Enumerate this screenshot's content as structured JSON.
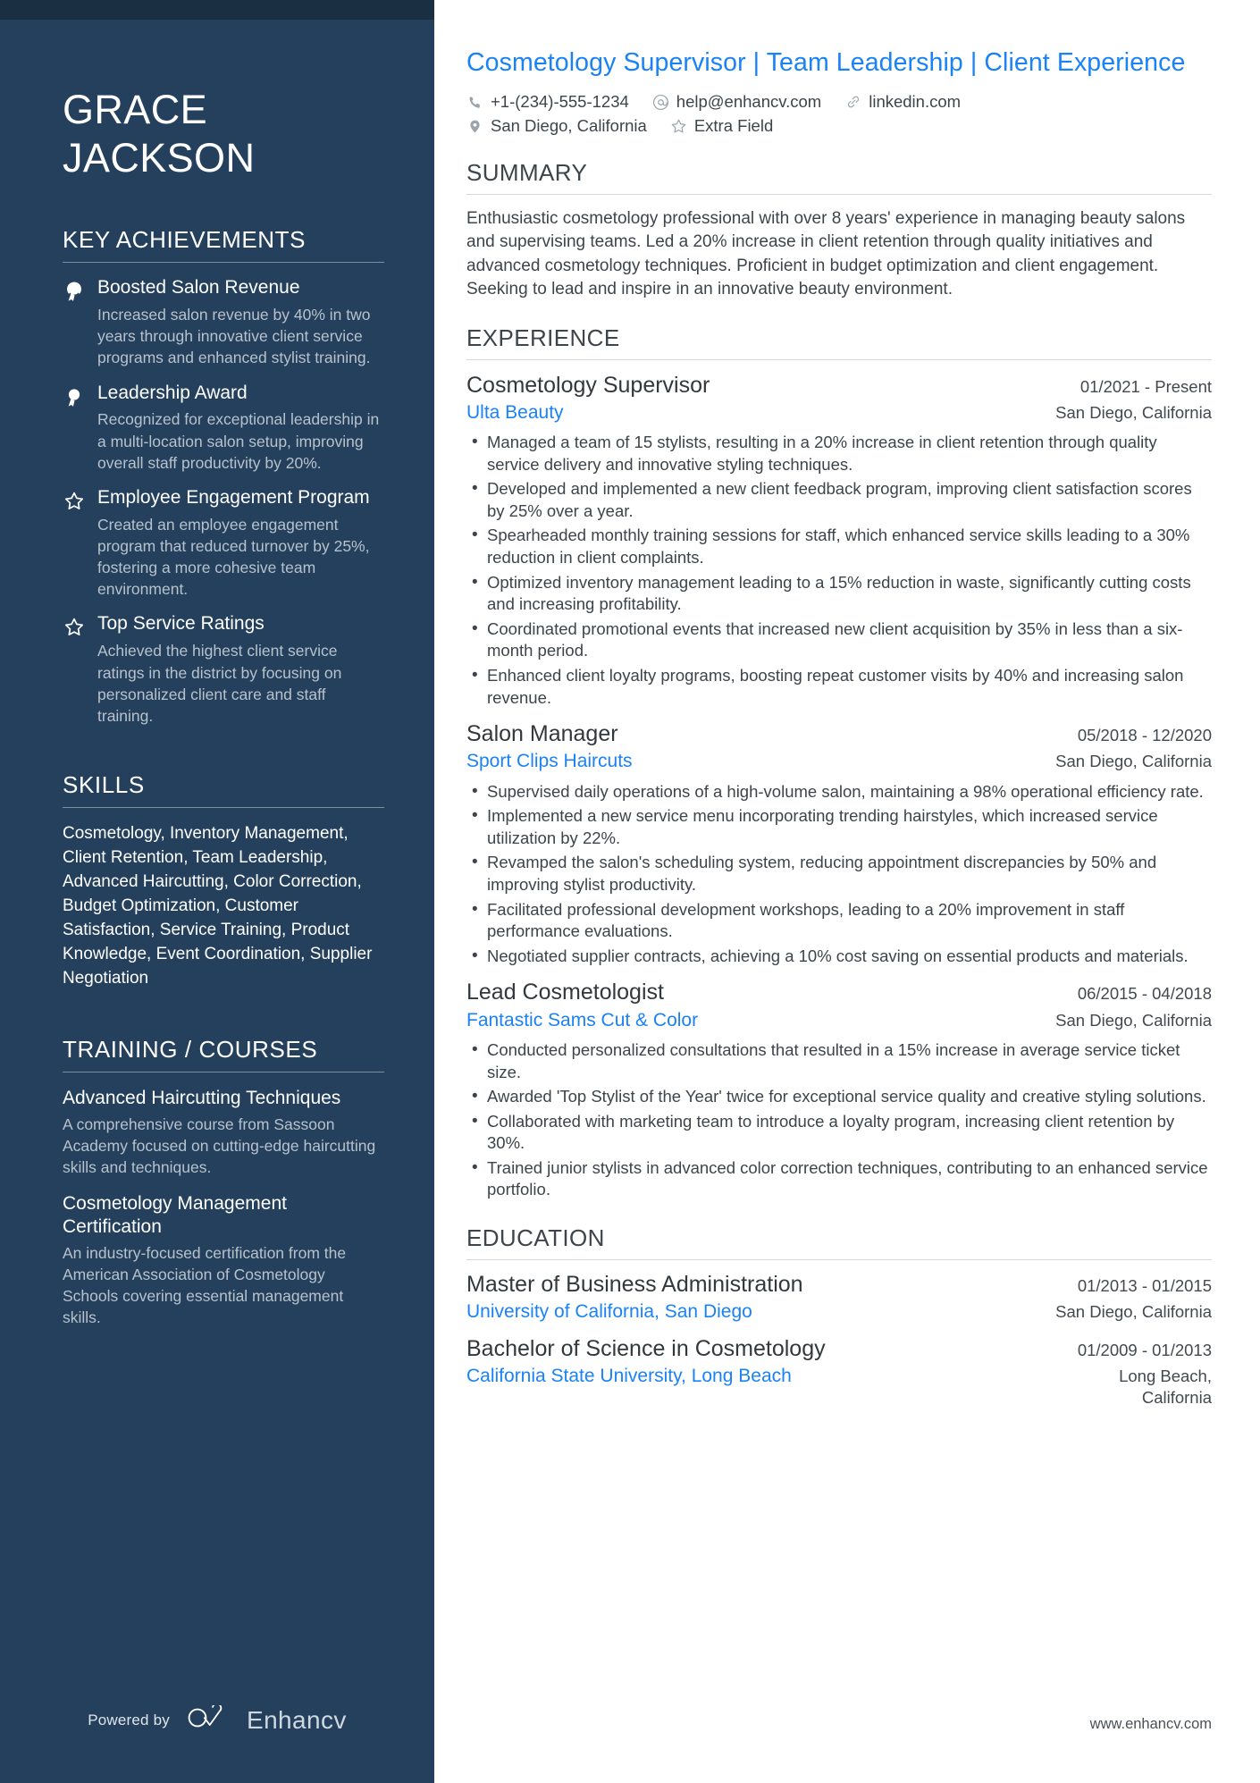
{
  "person": {
    "name": "GRACE\nJACKSON",
    "headline": "Cosmetology Supervisor | Team Leadership | Client Experience"
  },
  "contacts": {
    "row1": [
      {
        "icon": "phone-icon",
        "text": "+1-(234)-555-1234"
      },
      {
        "icon": "email-icon",
        "text": "help@enhancv.com"
      },
      {
        "icon": "link-icon",
        "text": "linkedin.com"
      }
    ],
    "row2": [
      {
        "icon": "location-pin-icon",
        "text": "San Diego, California"
      },
      {
        "icon": "star-icon",
        "text": "Extra Field"
      }
    ]
  },
  "sidebar": {
    "achievements_title": "KEY ACHIEVEMENTS",
    "achievements": [
      {
        "icon": "award-badge-icon",
        "title": "Boosted Salon Revenue",
        "desc": "Increased salon revenue by 40% in two years through innovative client service programs and enhanced stylist training."
      },
      {
        "icon": "award-badge-icon",
        "title": "Leadership Award",
        "desc": "Recognized for exceptional leadership in a multi-location salon setup, improving overall staff productivity by 20%."
      },
      {
        "icon": "star-outline-icon",
        "title": "Employee Engagement Program",
        "desc": "Created an employee engagement program that reduced turnover by 25%, fostering a more cohesive team environment."
      },
      {
        "icon": "star-outline-icon",
        "title": "Top Service Ratings",
        "desc": "Achieved the highest client service ratings in the district by focusing on personalized client care and staff training."
      }
    ],
    "skills_title": "SKILLS",
    "skills_text": "Cosmetology, Inventory Management, Client Retention, Team Leadership, Advanced Haircutting, Color Correction, Budget Optimization, Customer Satisfaction, Service Training, Product Knowledge, Event Coordination, Supplier Negotiation",
    "training_title": "TRAINING / COURSES",
    "courses": [
      {
        "title": "Advanced Haircutting Techniques",
        "desc": "A comprehensive course from Sassoon Academy focused on cutting-edge haircutting skills and techniques."
      },
      {
        "title": "Cosmetology Management Certification",
        "desc": "An industry-focused certification from the American Association of Cosmetology Schools covering essential management skills."
      }
    ],
    "footer": {
      "powered_by": "Powered by",
      "brand": "Enhancv"
    }
  },
  "main": {
    "summary_title": "SUMMARY",
    "summary_text": "Enthusiastic cosmetology professional with over 8 years' experience in managing beauty salons and supervising teams. Led a 20% increase in client retention through quality initiatives and advanced cosmetology techniques. Proficient in budget optimization and client engagement. Seeking to lead and inspire in an innovative beauty environment.",
    "experience_title": "EXPERIENCE",
    "experience": [
      {
        "role": "Cosmetology Supervisor",
        "date": "01/2021 - Present",
        "company": "Ulta Beauty",
        "location": "San Diego, California",
        "bullets": [
          "Managed a team of 15 stylists, resulting in a 20% increase in client retention through quality service delivery and innovative styling techniques.",
          "Developed and implemented a new client feedback program, improving client satisfaction scores by 25% over a year.",
          "Spearheaded monthly training sessions for staff, which enhanced service skills leading to a 30% reduction in client complaints.",
          "Optimized inventory management leading to a 15% reduction in waste, significantly cutting costs and increasing profitability.",
          "Coordinated promotional events that increased new client acquisition by 35% in less than a six-month period.",
          "Enhanced client loyalty programs, boosting repeat customer visits by 40% and increasing salon revenue."
        ]
      },
      {
        "role": "Salon Manager",
        "date": "05/2018 - 12/2020",
        "company": "Sport Clips Haircuts",
        "location": "San Diego, California",
        "bullets": [
          "Supervised daily operations of a high-volume salon, maintaining a 98% operational efficiency rate.",
          "Implemented a new service menu incorporating trending hairstyles, which increased service utilization by 22%.",
          "Revamped the salon's scheduling system, reducing appointment discrepancies by 50% and improving stylist productivity.",
          "Facilitated professional development workshops, leading to a 20% improvement in staff performance evaluations.",
          "Negotiated supplier contracts, achieving a 10% cost saving on essential products and materials."
        ]
      },
      {
        "role": "Lead Cosmetologist",
        "date": "06/2015 - 04/2018",
        "company": "Fantastic Sams Cut & Color",
        "location": "San Diego, California",
        "bullets": [
          "Conducted personalized consultations that resulted in a 15% increase in average service ticket size.",
          "Awarded 'Top Stylist of the Year' twice for exceptional service quality and creative styling solutions.",
          "Collaborated with marketing team to introduce a loyalty program, increasing client retention by 30%.",
          "Trained junior stylists in advanced color correction techniques, contributing to an enhanced service portfolio."
        ]
      }
    ],
    "education_title": "EDUCATION",
    "education": [
      {
        "degree": "Master of Business Administration",
        "date": "01/2013 - 01/2015",
        "school": "University of California, San Diego",
        "location": "San Diego, California"
      },
      {
        "degree": "Bachelor of Science in Cosmetology",
        "date": "01/2009 - 01/2013",
        "school": "California State University, Long Beach",
        "location": "Long Beach, California"
      }
    ],
    "footer_url": "www.enhancv.com"
  }
}
